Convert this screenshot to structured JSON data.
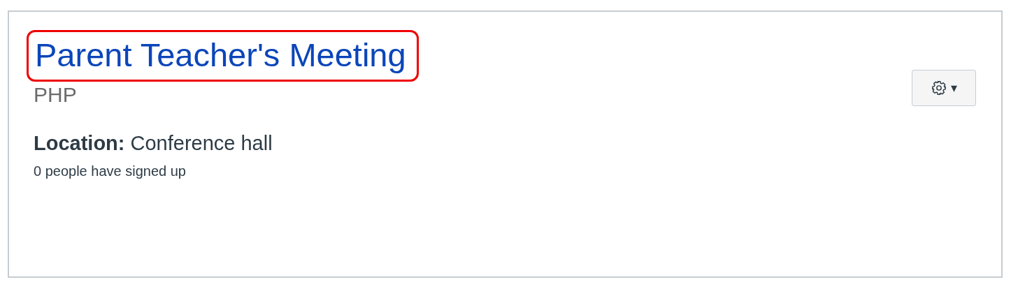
{
  "event": {
    "title": "Parent Teacher's Meeting",
    "highlighted": true,
    "course": "PHP",
    "location_label": "Location:",
    "location": "Conference hall",
    "signups": "0 people have signed up"
  },
  "settings_button": {
    "caret": "▾"
  }
}
